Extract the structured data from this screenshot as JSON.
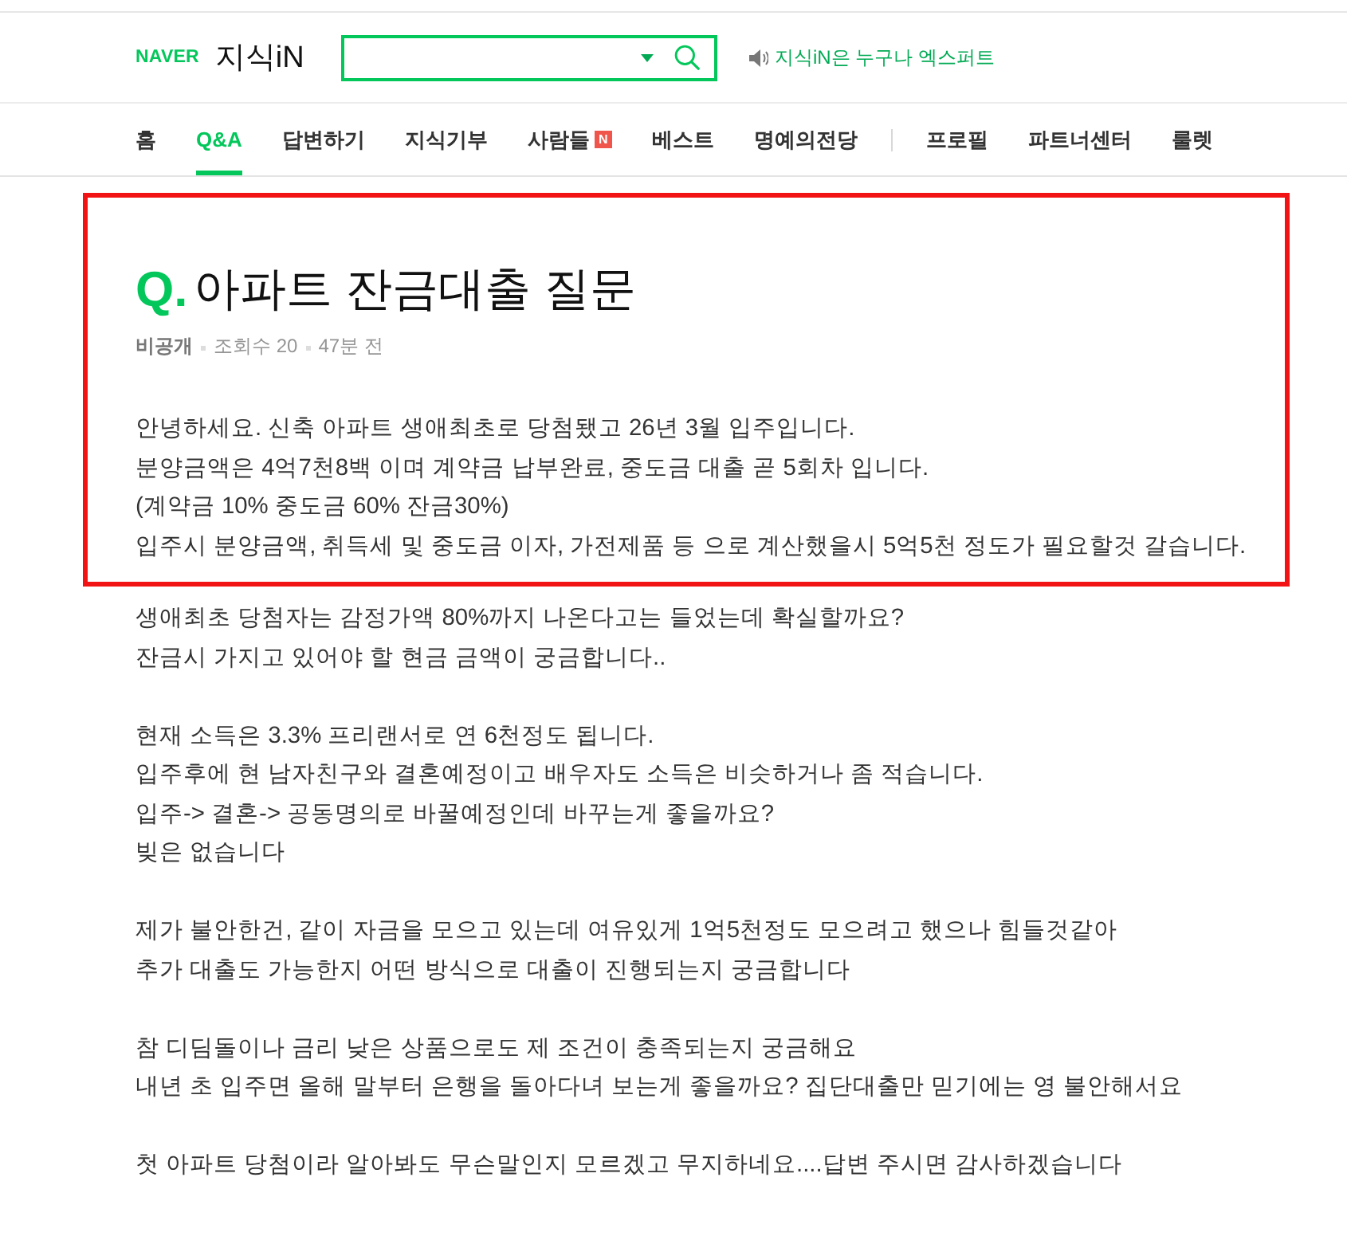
{
  "header": {
    "logo": {
      "brand": "NAVER",
      "service": "지식iN"
    },
    "search": {
      "dropdown": true
    },
    "notice": {
      "text": "지식iN은 누구나 엑스퍼트"
    }
  },
  "nav": {
    "groups": [
      [
        {
          "label": "홈",
          "selected": false
        },
        {
          "label": "Q&A",
          "selected": true
        },
        {
          "label": "답변하기",
          "selected": false
        },
        {
          "label": "지식기부",
          "selected": false
        },
        {
          "label": "사람들",
          "selected": false,
          "badge": "N"
        },
        {
          "label": "베스트",
          "selected": false
        },
        {
          "label": "명예의전당",
          "selected": false
        }
      ],
      [
        {
          "label": "프로필",
          "selected": false
        },
        {
          "label": "파트너센터",
          "selected": false
        },
        {
          "label": "룰렛",
          "selected": false
        }
      ]
    ]
  },
  "question": {
    "highlighted": true,
    "marker": "Q.",
    "title": "아파트 잔금대출 질문",
    "meta": [
      {
        "kind": "author",
        "text": "비공개"
      },
      {
        "kind": "views",
        "text": "조회수 20"
      },
      {
        "kind": "time",
        "text": "47분 전"
      }
    ],
    "intro": [
      "안녕하세요. 신축 아파트 생애최초로 당첨됐고 26년 3월 입주입니다.",
      "분양금액은 4억7천8백 이며 계약금 납부완료, 중도금 대출 곧 5회차 입니다.",
      "(계약금 10% 중도금 60% 잔금30%)",
      "입주시 분양금액, 취득세 및 중도금 이자, 가전제품 등 으로 계산했을시 5억5천 정도가 필요할것 갈습니다."
    ]
  },
  "body": [
    [
      "생애최초 당첨자는 감정가액 80%까지 나온다고는 들었는데 확실할까요?",
      "잔금시 가지고 있어야 할 현금 금액이 궁금합니다.."
    ],
    [
      "현재 소득은 3.3% 프리랜서로 연 6천정도 됩니다.",
      "입주후에 현 남자친구와 결혼예정이고 배우자도 소득은 비슷하거나 좀 적습니다.",
      "입주-> 결혼-> 공동명의로 바꿀예정인데 바꾸는게 좋을까요?",
      "빚은 없습니다"
    ],
    [
      "제가 불안한건, 같이 자금을 모으고 있는데 여유있게 1억5천정도 모으려고 했으나 힘들것같아",
      "추가 대출도 가능한지 어떤 방식으로 대출이 진행되는지 궁금합니다"
    ],
    [
      "참 디딤돌이나 금리 낮은 상품으로도 제 조건이 충족되는지 궁금해요",
      "내년 초 입주면 올해 말부터 은행을 돌아다녀 보는게 좋을까요? 집단대출만 믿기에는 영 불안해서요"
    ],
    [
      "첫 아파트 당첨이라 알아봐도 무슨말인지 모르겠고 무지하네요....답변 주시면 감사하겠습니다"
    ]
  ]
}
